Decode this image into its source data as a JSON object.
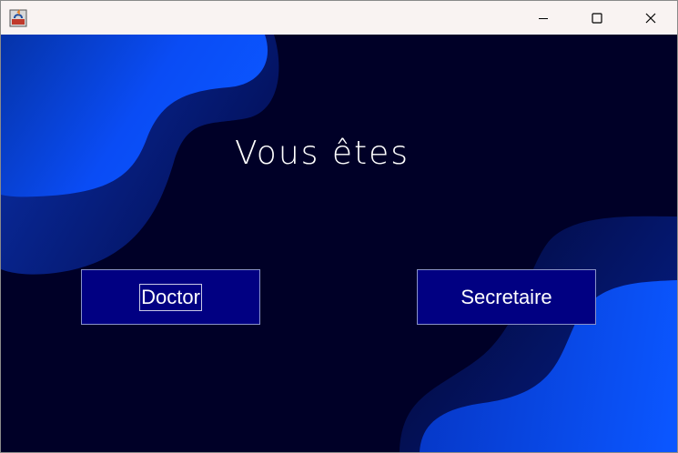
{
  "window": {
    "title": "",
    "icons": {
      "app": "java-app-icon",
      "minimize": "minimize-icon",
      "maximize": "maximize-icon",
      "close": "close-icon"
    }
  },
  "main": {
    "heading": "Vous êtes",
    "buttons": {
      "doctor_label": "Doctor",
      "secretary_label": "Secretaire"
    }
  },
  "colors": {
    "background": "#000027",
    "button": "#010082",
    "blob_light": "#0a4cf5",
    "blob_dark": "#061a8c",
    "titlebar": "#f9f3f2"
  }
}
